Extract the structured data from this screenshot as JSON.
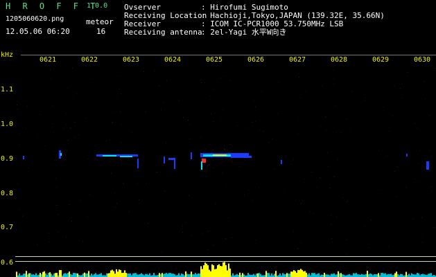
{
  "header": {
    "title": "H R O F F T",
    "version": "1.0.0",
    "filename": "1205060620.png",
    "meteor_label": "meteor",
    "datetime": "12.05.06 06:20",
    "meteor_count": "16"
  },
  "info": [
    {
      "label": "Ovserver",
      "value": ": Hirofumi Sugimoto"
    },
    {
      "label": "Receiving Location",
      "value": ": Hachioji,Tokyo,JAPAN (139.32E, 35.66N)"
    },
    {
      "label": "Receiver",
      "value": ": ICOM IC-PCR1000 53.750MHz LSB"
    },
    {
      "label": "Receiving antenna",
      "value": ": 2el-Yagi 水平W向き"
    }
  ],
  "axes": {
    "y_unit": "kHz",
    "x_ticks": [
      "0621",
      "0622",
      "0623",
      "0624",
      "0625",
      "0626",
      "0627",
      "0628",
      "0629",
      "0630"
    ],
    "y_ticks": [
      "1.1",
      "1.0",
      "0.9",
      "0.8",
      "0.7",
      "0.6"
    ]
  },
  "colors": {
    "label_green": "#57e38a",
    "tick_yellow": "#f0f000",
    "echo_blue": "#1a3cff",
    "echo_cyan": "#00e5ff",
    "echo_yellow": "#ffff00",
    "echo_red": "#ff2a2a"
  }
}
